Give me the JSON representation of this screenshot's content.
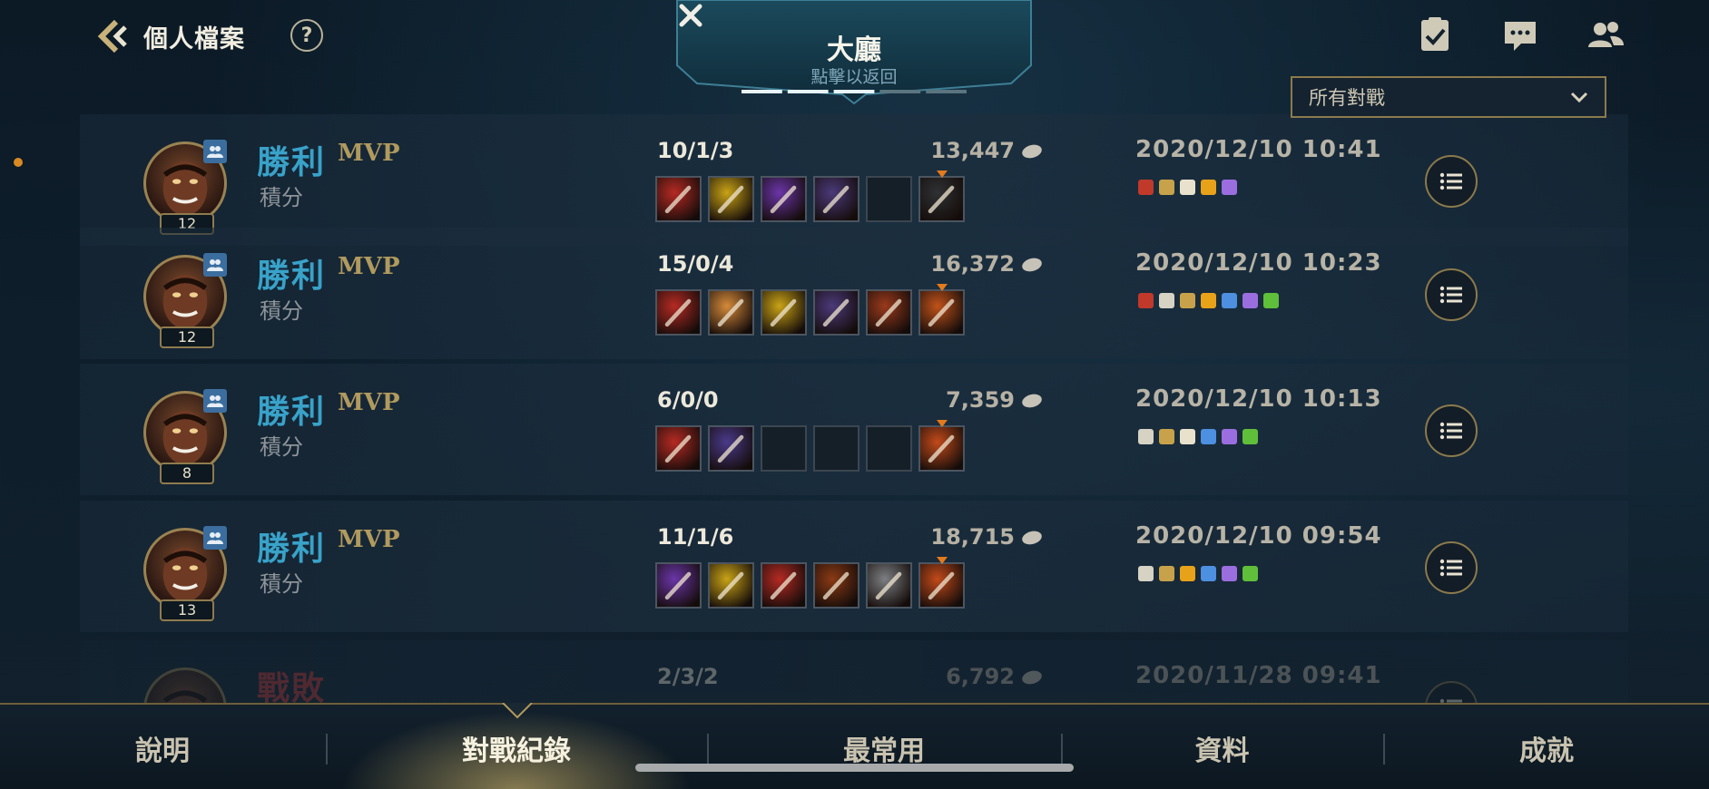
{
  "header": {
    "title": "個人檔案",
    "help_label": "?",
    "lobby": {
      "title": "大廳",
      "subtitle": "點擊以返回",
      "progress_segments": 5,
      "active_segment": 3
    },
    "filter": {
      "selected": "所有對戰"
    },
    "icons": [
      "checklist-icon",
      "chat-icon",
      "friends-icon"
    ]
  },
  "matches": [
    {
      "level": "12",
      "result": "勝利",
      "mvp": "MVP",
      "mode": "積分",
      "kda": "10/1/3",
      "gold": "13,447",
      "date": "2020/12/10 10:41",
      "items": [
        {
          "color": "#b52a23"
        },
        {
          "color": "#c9a316"
        },
        {
          "color": "#6b35a8"
        },
        {
          "color": "#4b3a7a"
        },
        {
          "color": ""
        },
        {
          "color": "#2f3134",
          "trinket": true
        }
      ],
      "badges": [
        "#c0392b",
        "#c8a24a",
        "#e8e2cc",
        "#e8a21a",
        "#9b6ee0"
      ]
    },
    {
      "level": "12",
      "result": "勝利",
      "mvp": "MVP",
      "mode": "積分",
      "kda": "15/0/4",
      "gold": "16,372",
      "date": "2020/12/10 10:23",
      "items": [
        {
          "color": "#b52a23"
        },
        {
          "color": "#d58a3a"
        },
        {
          "color": "#c9a316"
        },
        {
          "color": "#4b3a7a"
        },
        {
          "color": "#9a3a1c"
        },
        {
          "color": "#c0521a",
          "trinket": true
        }
      ],
      "badges": [
        "#c0392b",
        "#d6d2c4",
        "#c8a24a",
        "#e8a21a",
        "#4d8fe0",
        "#9b6ee0",
        "#5fbf3a"
      ]
    },
    {
      "level": "8",
      "result": "勝利",
      "mvp": "MVP",
      "mode": "積分",
      "kda": "6/0/0",
      "gold": "7,359",
      "date": "2020/12/10 10:13",
      "items": [
        {
          "color": "#b52a23"
        },
        {
          "color": "#4a3a8a"
        },
        {
          "color": ""
        },
        {
          "color": ""
        },
        {
          "color": ""
        },
        {
          "color": "#c24a1a",
          "trinket": true
        }
      ],
      "badges": [
        "#d6d2c4",
        "#c8a24a",
        "#e8e2cc",
        "#4d8fe0",
        "#9b6ee0",
        "#5fbf3a"
      ]
    },
    {
      "level": "13",
      "result": "勝利",
      "mvp": "MVP",
      "mode": "積分",
      "kda": "11/1/6",
      "gold": "18,715",
      "date": "2020/12/10 09:54",
      "items": [
        {
          "color": "#6b35a8"
        },
        {
          "color": "#c9a316"
        },
        {
          "color": "#b52a23"
        },
        {
          "color": "#8a3a14"
        },
        {
          "color": "#7c7f82"
        },
        {
          "color": "#c24a1a",
          "trinket": true
        }
      ],
      "badges": [
        "#d6d2c4",
        "#c8a24a",
        "#e8a21a",
        "#4d8fe0",
        "#9b6ee0",
        "#5fbf3a"
      ]
    },
    {
      "level": "",
      "result": "戰敗",
      "mvp": "",
      "mode": "",
      "kda": "2/3/2",
      "gold": "6,792",
      "date": "2020/11/28 09:41",
      "items": [],
      "badges": [],
      "partial": true
    }
  ],
  "bottom_nav": {
    "items": [
      "說明",
      "對戰紀錄",
      "最常用",
      "資料",
      "成就"
    ],
    "active_index": 1
  },
  "colors": {
    "accent_gold": "#8c7a4c",
    "victory_blue": "#39a2c9",
    "mvp_gold": "#b19a5e"
  }
}
